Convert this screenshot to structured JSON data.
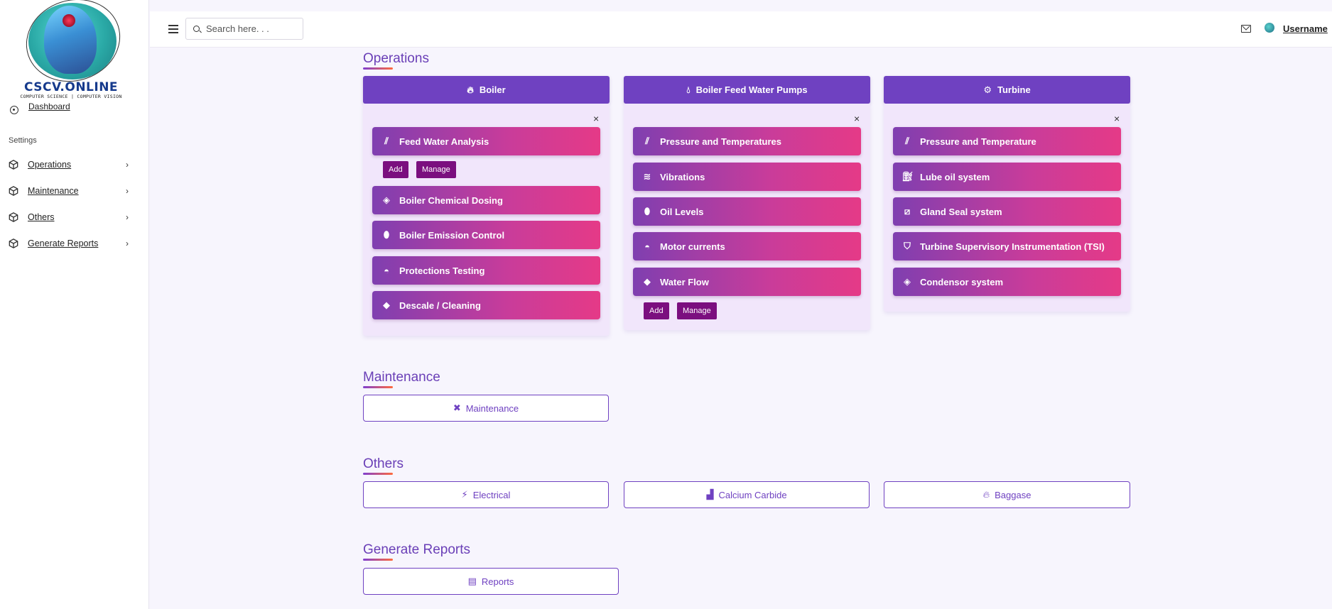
{
  "brand": {
    "name": "CSCV.ONLINE",
    "tagline": "COMPUTER SCIENCE | COMPUTER VISION"
  },
  "sidebar": {
    "dashboard_label": "Dashboard",
    "settings_label": "Settings",
    "items": [
      {
        "label": "Operations"
      },
      {
        "label": "Maintenance"
      },
      {
        "label": "Others"
      },
      {
        "label": "Generate Reports"
      }
    ]
  },
  "header": {
    "search_placeholder": "Search here. . .",
    "username": "Username"
  },
  "operations": {
    "title": "Operations",
    "columns": [
      {
        "title": "Boiler",
        "icon": "fire-icon",
        "items": [
          {
            "label": "Feed Water Analysis",
            "icon": "bars-icon"
          },
          {
            "label": "Boiler Chemical Dosing",
            "icon": "flask-icon"
          },
          {
            "label": "Boiler Emission Control",
            "icon": "pills-icon"
          },
          {
            "label": "Protections Testing",
            "icon": "gauge-icon"
          },
          {
            "label": "Descale / Cleaning",
            "icon": "eraser-icon"
          }
        ],
        "add_label": "Add",
        "manage_label": "Manage"
      },
      {
        "title": "Boiler Feed Water Pumps",
        "icon": "droplet-icon",
        "items": [
          {
            "label": "Pressure and Temperatures",
            "icon": "bars-icon"
          },
          {
            "label": "Vibrations",
            "icon": "wave-icon"
          },
          {
            "label": "Oil Levels",
            "icon": "pills-icon"
          },
          {
            "label": "Motor currents",
            "icon": "gauge-icon"
          },
          {
            "label": "Water Flow",
            "icon": "eraser-icon"
          }
        ],
        "add_label": "Add",
        "manage_label": "Manage"
      },
      {
        "title": "Turbine",
        "icon": "gears-icon",
        "items": [
          {
            "label": "Pressure and Temperature",
            "icon": "bars-icon"
          },
          {
            "label": "Lube oil system",
            "icon": "oilcan-icon"
          },
          {
            "label": "Gland Seal system",
            "icon": "bandage-icon"
          },
          {
            "label": "Turbine Supervisory Instrumentation (TSI)",
            "icon": "shield-icon"
          },
          {
            "label": "Condensor system",
            "icon": "tag-icon"
          }
        ]
      }
    ]
  },
  "maintenance": {
    "title": "Maintenance",
    "button_label": "Maintenance"
  },
  "others": {
    "title": "Others",
    "buttons": [
      {
        "label": "Electrical",
        "icon": "bolt-icon"
      },
      {
        "label": "Calcium Carbide",
        "icon": "industry-icon"
      },
      {
        "label": "Baggase",
        "icon": "fire-icon"
      }
    ]
  },
  "reports": {
    "title": "Generate Reports",
    "button_label": "Reports"
  },
  "colors": {
    "accent": "#6f41c1",
    "item_gradient_start": "#7f3fb0",
    "item_gradient_end": "#e53a87",
    "small_button": "#7b0f7f",
    "panel_bg": "#f1e6fb"
  }
}
